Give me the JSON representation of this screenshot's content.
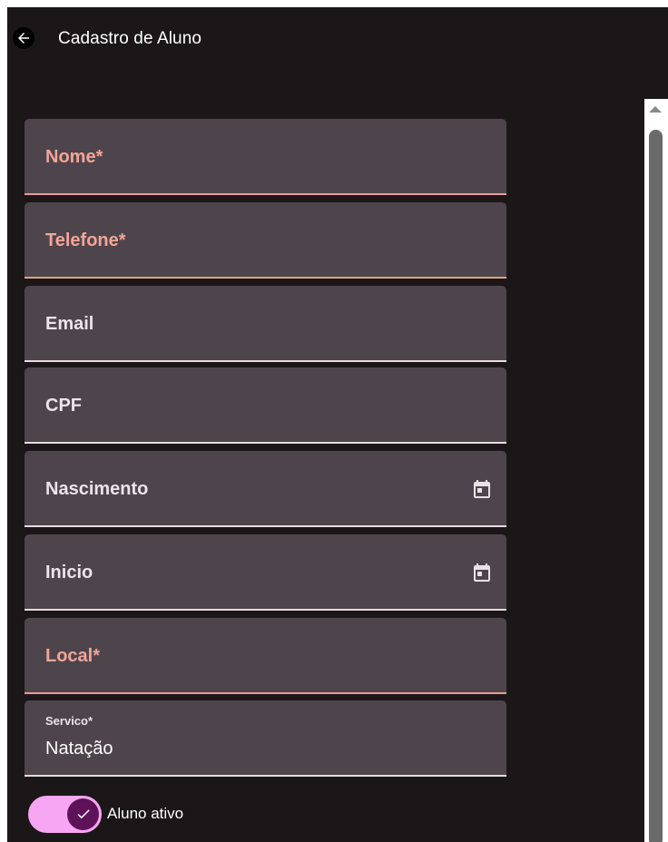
{
  "header": {
    "title": "Cadastro de Aluno",
    "back_icon": "arrow-left-icon"
  },
  "form": {
    "nome": {
      "label": "Nome*"
    },
    "telefone": {
      "label": "Telefone*"
    },
    "email": {
      "label": "Email"
    },
    "cpf": {
      "label": "CPF"
    },
    "nascimento": {
      "label": "Nascimento",
      "icon": "calendar-icon"
    },
    "inicio": {
      "label": "Inicio",
      "icon": "calendar-icon"
    },
    "local": {
      "label": "Local*"
    },
    "servico": {
      "label": "Servico*",
      "value": "Natação"
    }
  },
  "toggle": {
    "label": "Aluno ativo",
    "checked": true,
    "icon": "check-icon"
  },
  "colors": {
    "background": "#1b1719",
    "field_bg": "#4e454c",
    "error": "#f3a597",
    "toggle_track": "#f7a6f3",
    "toggle_knob": "#5e1259"
  }
}
